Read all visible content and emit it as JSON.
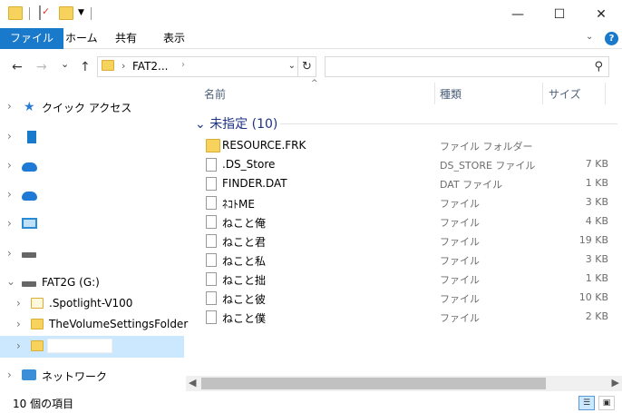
{
  "ribbon": {
    "tabs": [
      "ファイル",
      "ホーム",
      "共有",
      "表示"
    ]
  },
  "address": {
    "crumb": "FAT2..."
  },
  "search": {
    "placeholder": ""
  },
  "colors": {
    "accent": "#1979ca",
    "folder": "#f7d25c",
    "selected_bg": "#cce8ff",
    "group_text": "#1e3287"
  },
  "nav_tree": {
    "quick_access": "クイック アクセス",
    "drive": "FAT2G (G:)",
    "folder1": ".Spotlight-V100",
    "folder2": "TheVolumeSettingsFolder",
    "network": "ネットワーク"
  },
  "columns": {
    "name": "名前",
    "type": "種類",
    "size": "サイズ"
  },
  "group": {
    "label": "未指定 (10)"
  },
  "files": [
    {
      "name": "RESOURCE.FRK",
      "type": "ファイル フォルダー",
      "size": "",
      "kind": "folder"
    },
    {
      "name": ".DS_Store",
      "type": "DS_STORE ファイル",
      "size": "7 KB",
      "kind": "file"
    },
    {
      "name": "FINDER.DAT",
      "type": "DAT ファイル",
      "size": "1 KB",
      "kind": "file"
    },
    {
      "name": "ﾈｺﾄME",
      "type": "ファイル",
      "size": "3 KB",
      "kind": "file"
    },
    {
      "name": "ねこと俺",
      "type": "ファイル",
      "size": "4 KB",
      "kind": "file"
    },
    {
      "name": "ねこと君",
      "type": "ファイル",
      "size": "19 KB",
      "kind": "file"
    },
    {
      "name": "ねこと私",
      "type": "ファイル",
      "size": "3 KB",
      "kind": "file"
    },
    {
      "name": "ねこと拙",
      "type": "ファイル",
      "size": "1 KB",
      "kind": "file"
    },
    {
      "name": "ねこと彼",
      "type": "ファイル",
      "size": "10 KB",
      "kind": "file"
    },
    {
      "name": "ねこと僕",
      "type": "ファイル",
      "size": "2 KB",
      "kind": "file"
    }
  ],
  "status": {
    "count": "10 個の項目"
  },
  "icons": {
    "back": "←",
    "forward": "→",
    "recent": "⌄",
    "up": "↑",
    "refresh": "↻",
    "search": "⚲",
    "minimize": "—",
    "maximize": "☐",
    "close": "✕"
  }
}
